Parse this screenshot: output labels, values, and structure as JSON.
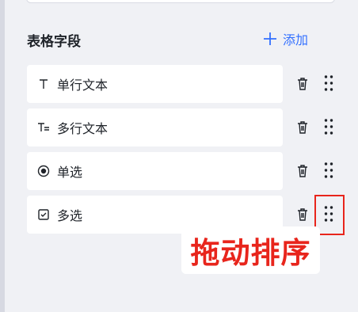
{
  "section": {
    "title": "表格字段",
    "add_label": "添加"
  },
  "fields": [
    {
      "label": "单行文本",
      "icon": "single-line-text-icon"
    },
    {
      "label": "多行文本",
      "icon": "multi-line-text-icon"
    },
    {
      "label": "单选",
      "icon": "radio-icon"
    },
    {
      "label": "多选",
      "icon": "checkbox-icon"
    }
  ],
  "annotation": {
    "text": "拖动排序"
  },
  "colors": {
    "accent": "#3370ff",
    "annotation": "#e8251c",
    "text": "#1f2329",
    "background": "#f0f1f5"
  }
}
